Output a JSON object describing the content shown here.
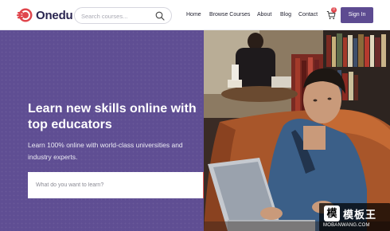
{
  "header": {
    "logo_text": "Onedu",
    "search": {
      "placeholder": "Search courses..."
    },
    "nav": {
      "home": "Home",
      "browse": "Browse Courses",
      "about": "About",
      "blog": "Blog",
      "contact": "Contact"
    },
    "cart_count": "0",
    "signin_label": "Sign In"
  },
  "hero": {
    "title": "Learn new skills online with top educators",
    "subtitle": "Learn 100% online with world-class universities and industry experts.",
    "search_placeholder": "What do you want to learn?"
  },
  "watermark": {
    "logo_char": "模",
    "cn_text": "模板王",
    "en_text": "MOBANWANG.COM"
  },
  "colors": {
    "brand": "#5d4b91",
    "hero_bg": "#5f4e93",
    "accent": "#e35458",
    "logo": "#e0464d"
  },
  "icons": [
    "logo-icon",
    "search-icon",
    "cart-icon",
    "search-button-icon"
  ]
}
